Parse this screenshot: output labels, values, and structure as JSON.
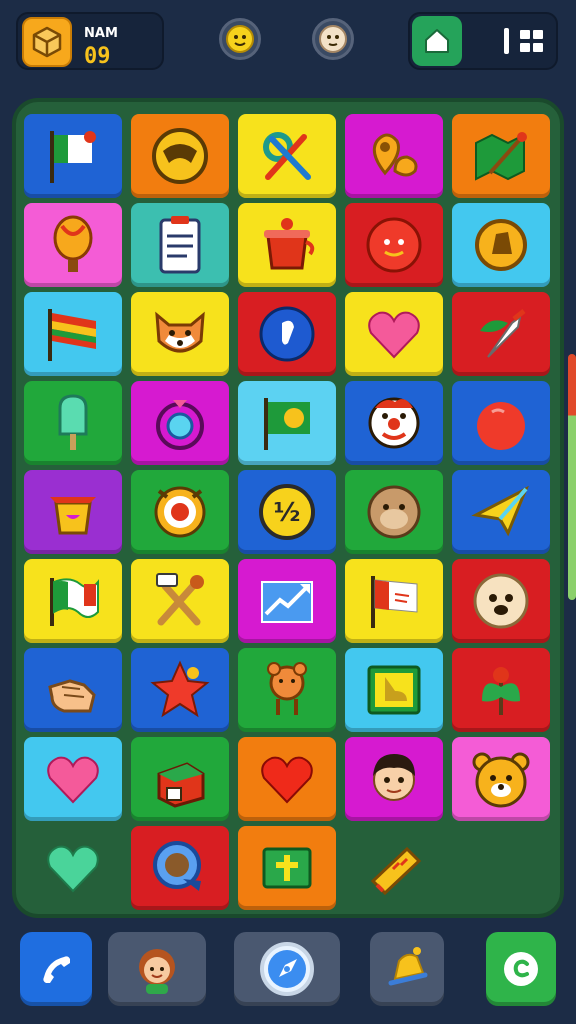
{
  "header": {
    "player_name": "NAM",
    "player_level": "09",
    "player_icon": "box-icon",
    "emoji_buttons": [
      "smiley-face-icon",
      "neutral-face-icon"
    ],
    "home_icon": "home-icon",
    "menu_icon": "menu-grid-icon"
  },
  "colors": {
    "background": "#1c2c46",
    "board": "#25603a",
    "blue": "#1f63d4",
    "orange": "#f27d0f",
    "yellow": "#f7e21c",
    "magenta": "#d61ad0",
    "pink": "#f45cd6",
    "teal": "#3cbfb0",
    "red": "#d81e22",
    "cyan": "#43c8ef",
    "green": "#21a83b",
    "purple": "#9a2fd1",
    "skyblue": "#5cd2f2"
  },
  "board": {
    "tiles": [
      {
        "icon": "flag-icon",
        "color": "blue"
      },
      {
        "icon": "face-circle-icon",
        "color": "orange"
      },
      {
        "icon": "gear-tools-icon",
        "color": "yellow"
      },
      {
        "icon": "map-pin-icon",
        "color": "magenta"
      },
      {
        "icon": "brush-map-icon",
        "color": "orange"
      },
      {
        "icon": "hot-air-balloon-icon",
        "color": "pink"
      },
      {
        "icon": "clipboard-icon",
        "color": "teal"
      },
      {
        "icon": "gift-pot-icon",
        "color": "yellow"
      },
      {
        "icon": "red-ball-face-icon",
        "color": "red"
      },
      {
        "icon": "coin-icon",
        "color": "cyan"
      },
      {
        "icon": "rainbow-flag-icon",
        "color": "cyan"
      },
      {
        "icon": "fox-face-icon",
        "color": "yellow"
      },
      {
        "icon": "blue-orb-icon",
        "color": "red"
      },
      {
        "icon": "heart-icon",
        "color": "yellow"
      },
      {
        "icon": "knife-leaf-icon",
        "color": "red"
      },
      {
        "icon": "ice-pop-icon",
        "color": "green"
      },
      {
        "icon": "gem-ring-icon",
        "color": "magenta"
      },
      {
        "icon": "green-flag-icon",
        "color": "skyblue"
      },
      {
        "icon": "clown-face-icon",
        "color": "blue"
      },
      {
        "icon": "red-apple-icon",
        "color": "blue"
      },
      {
        "icon": "teapot-icon",
        "color": "purple"
      },
      {
        "icon": "target-icon",
        "color": "green"
      },
      {
        "icon": "half-coin-icon",
        "color": "blue"
      },
      {
        "icon": "monkey-face-icon",
        "color": "green"
      },
      {
        "icon": "paper-plane-icon",
        "color": "blue"
      },
      {
        "icon": "wavy-flag-icon",
        "color": "yellow"
      },
      {
        "icon": "hammer-icon",
        "color": "yellow"
      },
      {
        "icon": "chart-arrow-icon",
        "color": "magenta"
      },
      {
        "icon": "red-flag-icon",
        "color": "yellow"
      },
      {
        "icon": "lion-face-icon",
        "color": "red"
      },
      {
        "icon": "hand-icon",
        "color": "blue"
      },
      {
        "icon": "star-icon",
        "color": "blue"
      },
      {
        "icon": "teddy-bear-icon",
        "color": "green"
      },
      {
        "icon": "book-icon",
        "color": "cyan"
      },
      {
        "icon": "plant-icon",
        "color": "red"
      },
      {
        "icon": "heart-icon",
        "color": "cyan"
      },
      {
        "icon": "house-box-icon",
        "color": "green"
      },
      {
        "icon": "red-heart-icon",
        "color": "orange"
      },
      {
        "icon": "boy-face-icon",
        "color": "magenta"
      },
      {
        "icon": "bear-face-icon",
        "color": "pink"
      },
      {
        "icon": "green-heart-icon",
        "color": "none"
      },
      {
        "icon": "badge-icon",
        "color": "red"
      },
      {
        "icon": "cross-card-icon",
        "color": "orange"
      },
      {
        "icon": "candy-bar-icon",
        "color": "none"
      }
    ]
  },
  "footer": {
    "buttons": [
      {
        "icon": "phone-icon",
        "color": "#1f6ee0"
      },
      {
        "icon": "girl-avatar-icon",
        "color": "#4a5870"
      },
      {
        "icon": "compass-icon",
        "color": "#4a5870"
      },
      {
        "icon": "bell-icon",
        "color": "#4a5870"
      },
      {
        "icon": "chat-icon",
        "color": "#2fb44a"
      }
    ]
  }
}
